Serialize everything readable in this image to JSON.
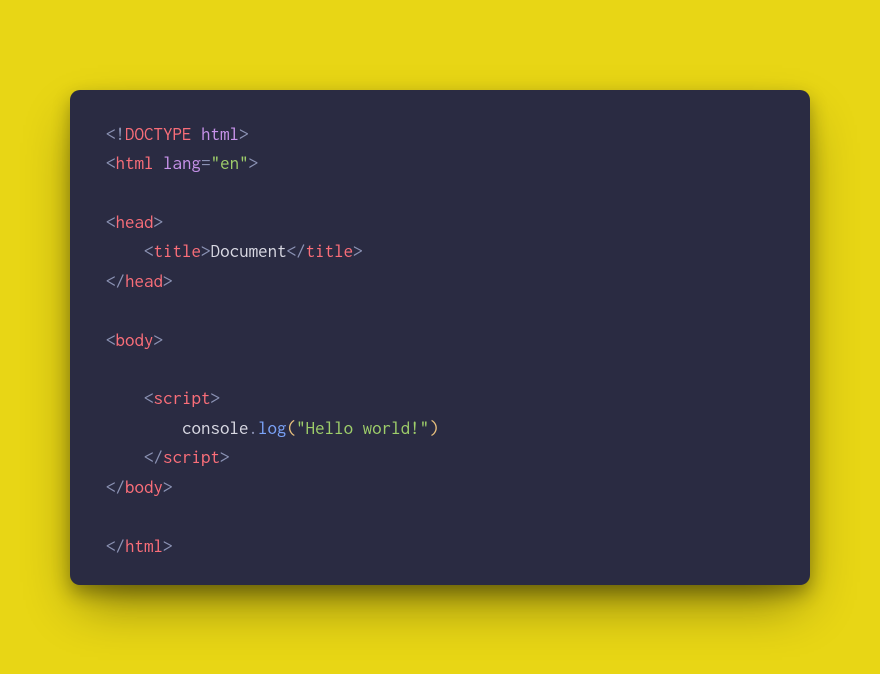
{
  "colors": {
    "background": "#e8d615",
    "panel": "#2a2b42",
    "punctuation": "#8b92b4",
    "tag_red": "#fa6e79",
    "tag_blue": "#7aa2f7",
    "attr_purple": "#c792ea",
    "string_green": "#9ece6a",
    "text_default": "#d9d9e3",
    "paren_gold": "#e8c07d"
  },
  "code": {
    "line1": {
      "open": "<!",
      "doctype": "DOCTYPE",
      "space": " ",
      "html": "html",
      "close": ">"
    },
    "line2": {
      "open": "<",
      "tag": "html",
      "attr": "lang",
      "eq": "=",
      "val": "\"en\"",
      "close": ">"
    },
    "line4": {
      "open": "<",
      "tag": "head",
      "close": ">"
    },
    "line5": {
      "indent": "    ",
      "open1": "<",
      "tag1": "title",
      "close1": ">",
      "text": "Document",
      "open2": "</",
      "tag2": "title",
      "close2": ">"
    },
    "line6": {
      "open": "</",
      "tag": "head",
      "close": ">"
    },
    "line8": {
      "open": "<",
      "tag": "body",
      "close": ">"
    },
    "line10": {
      "indent": "    ",
      "open": "<",
      "tag": "script",
      "close": ">"
    },
    "line11": {
      "indent": "        ",
      "obj": "console",
      "dot": ".",
      "method": "log",
      "lp": "(",
      "str": "\"Hello world!\"",
      "rp": ")"
    },
    "line12": {
      "indent": "    ",
      "open": "</",
      "tag": "script",
      "close": ">"
    },
    "line13": {
      "open": "</",
      "tag": "body",
      "close": ">"
    },
    "line15": {
      "open": "</",
      "tag": "html",
      "close": ">"
    }
  }
}
